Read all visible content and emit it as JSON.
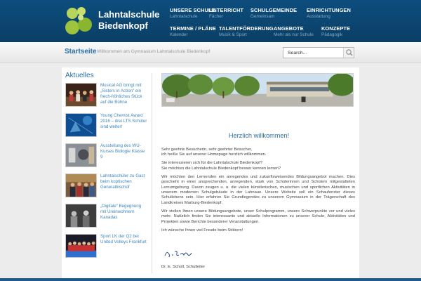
{
  "brand": {
    "line1": "Lahntalschule",
    "line2": "Biedenkopf",
    "logo_colors": [
      "#9dc43c",
      "#b7d55a",
      "#c8df6b",
      "#8ab52f"
    ]
  },
  "nav": [
    {
      "title": "UNSERE SCHULE",
      "sub": "Lahntalschule"
    },
    {
      "title": "UNTERRICHT",
      "sub": "Fächer"
    },
    {
      "title": "SCHULGEMEINDE",
      "sub": "Gemeinsam"
    },
    {
      "title": "EINRICHTUNGEN",
      "sub": "Ausstattung"
    },
    {
      "title": "TERMINE / PLÄNE",
      "sub": "Kalender"
    },
    {
      "title": "TALENTFÖRDERUNG",
      "sub": "Musik & Sport"
    },
    {
      "title": "ANGEBOTE",
      "sub": "Mehr als nur Schule"
    },
    {
      "title": "KONZEPTE",
      "sub": "Pädagogik"
    }
  ],
  "breadcrumb": {
    "home": "Startseite",
    "subtitle": "Willkommen am Gymnasium Lahntalschule Biedenkopf"
  },
  "search": {
    "placeholder": "Search..."
  },
  "sidebar": {
    "title": "Aktuelles",
    "items": [
      {
        "text": "Musical AG bringt mit „Sisters in Action“ ein frech-fröhliches Stück auf die Bühne"
      },
      {
        "text": "Young Chemist Award 2016 – drei LTS Schüler sind weiter!"
      },
      {
        "text": "Ausstellung des WU-Kurses Biologie Klasse 9"
      },
      {
        "text": "Lahntalschüler zu Gast beim koptischen Generalbischof"
      },
      {
        "text": "„Digitale“ Begegnung mit Ureinwohnern Kanadas"
      },
      {
        "text": "Sport LK der Q2 bei United Volleys Frankfurt"
      }
    ]
  },
  "main": {
    "welcome": "Herzlich willkommen!",
    "paragraphs": [
      "Sehr geehrte Besucherin, sehr geehrter Besucher,\nich heiße Sie auf unserer Homepage herzlich willkommen.",
      "Sie interessieren sich für die Lahntalschule Biedenkopf?\nSie möchten die Lahntalschule Biedenkopf besser kennen lernen?",
      "Wir möchten den Lernenden ein anregendes und zukunftsweisendes Bildungsangebot machen. Dies geschieht in einer ansprechenden, anregenden, stark von Schülerinnen und Schülern mitgestalteten Lernumgebung. Davon zeugen u. a. die vielen künstlerischen, musischen und sportlichen Aktivitäten in unserem modernen Schulgebäude in der Lahnaue. Unsere Website soll ein Schaufenster dieses Schullebens sein. Hier erfahren Sie Grundlegendes zu unserem Gymnasium in der Trägerschaft des Landkreises Marburg-Biedenkopf.",
      "Wir stellen Ihnen unsere Bildungsangebote, unser Schulprogramm, unsere Schwerpunkte vor und vieles mehr. Natürlich finden Sie interessante und aktuelle Informationen zu unserer Schule, Aktivitäten und Projekten sowie Berichte besonderer Veranstaltungen.",
      "Ich wünsche Ihnen viel Freude beim Stöbern!"
    ],
    "signature": "Dr. E. Scholl, Schulleiter"
  },
  "colors": {
    "header": "#0d4d7d",
    "link": "#3d86bf",
    "accent": "#2a6fa8",
    "logo_green": "#9dc43c"
  }
}
